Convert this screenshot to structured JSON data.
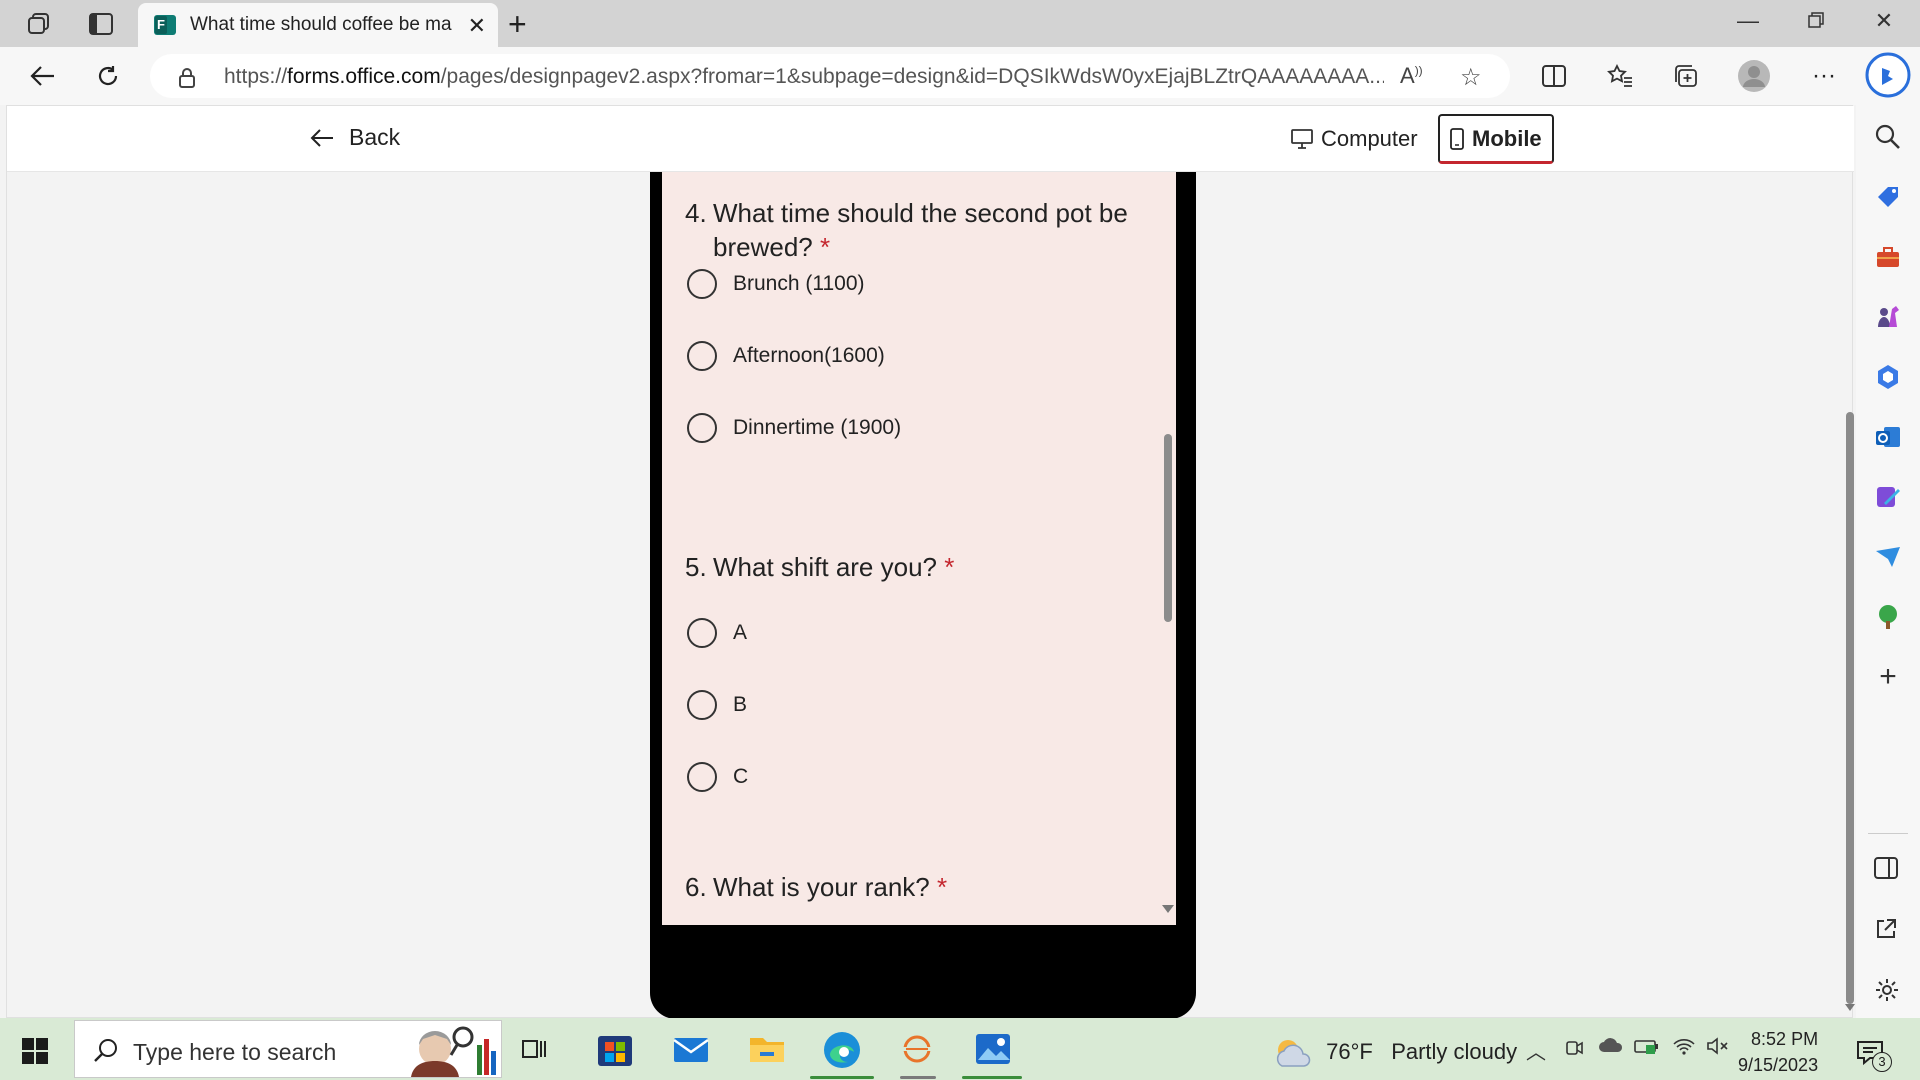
{
  "browser": {
    "tab_title": "What time should coffee be mad",
    "url_prefix": "https://",
    "url_domain": "forms.office.com",
    "url_path": "/pages/designpagev2.aspx?fromar=1&subpage=design&id=DQSIkWdsW0yxEjajBLZtrQAAAAAAAA..."
  },
  "preview": {
    "back_label": "Back",
    "computer_label": "Computer",
    "mobile_label": "Mobile"
  },
  "questions": [
    {
      "number": "4.",
      "text": "What time should the second pot be brewed?",
      "required": "*",
      "options": [
        "Brunch (1100)",
        "Afternoon(1600)",
        "Dinnertime (1900)"
      ]
    },
    {
      "number": "5.",
      "text": "What shift are you?",
      "required": "*",
      "options": [
        "A",
        "B",
        "C"
      ]
    },
    {
      "number": "6.",
      "text": "What is your rank?",
      "required": "*",
      "options": []
    }
  ],
  "taskbar": {
    "search_placeholder": "Type here to search",
    "weather_temp": "76°F",
    "weather_text": "Partly cloudy",
    "time": "8:52 PM",
    "date": "9/15/2023",
    "notification_count": "3"
  },
  "colors": {
    "form_background": "#f8e9e6",
    "required_star": "#c4262e",
    "active_underline": "#c4262e"
  }
}
